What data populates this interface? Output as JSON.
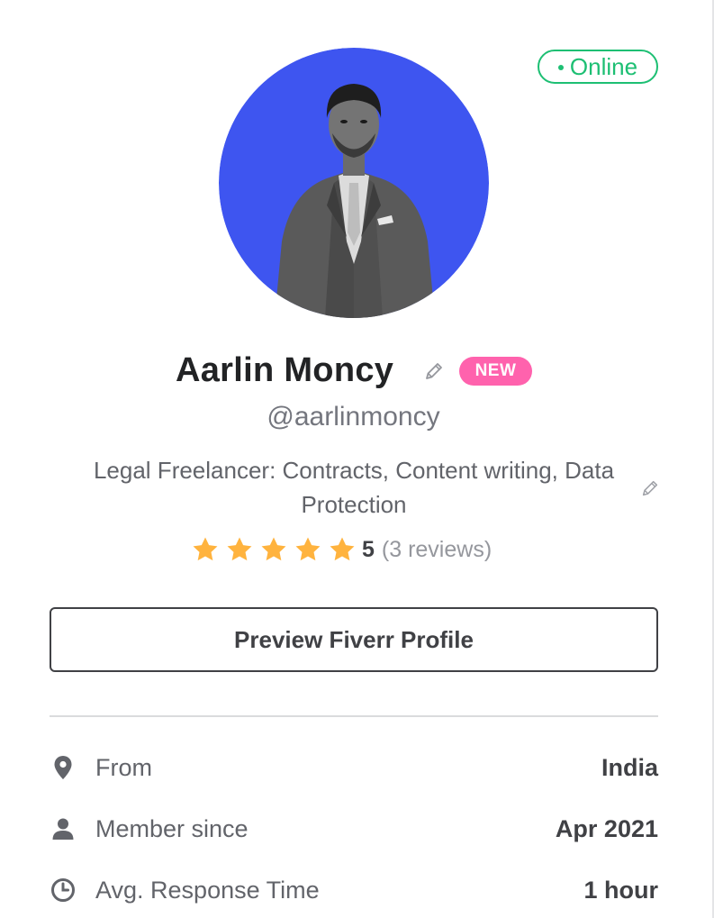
{
  "status": {
    "online_label": "Online"
  },
  "profile": {
    "name": "Aarlin Moncy",
    "badge": "NEW",
    "username": "@aarlinmoncy",
    "tagline": "Legal Freelancer: Contracts, Content writing, Data Protection",
    "rating": {
      "stars": 5,
      "score": "5",
      "reviews": "(3 reviews)"
    }
  },
  "actions": {
    "preview_label": "Preview Fiverr Profile"
  },
  "stats": [
    {
      "icon": "location-pin-icon",
      "label": "From",
      "value": "India"
    },
    {
      "icon": "user-icon",
      "label": "Member since",
      "value": "Apr 2021"
    },
    {
      "icon": "clock-icon",
      "label": "Avg. Response Time",
      "value": "1 hour"
    }
  ],
  "colors": {
    "online_green": "#1dbf73",
    "avatar_bg": "#3e55f0",
    "new_badge": "#ff62ad",
    "star": "#ffb33e",
    "text_dark": "#404145"
  }
}
